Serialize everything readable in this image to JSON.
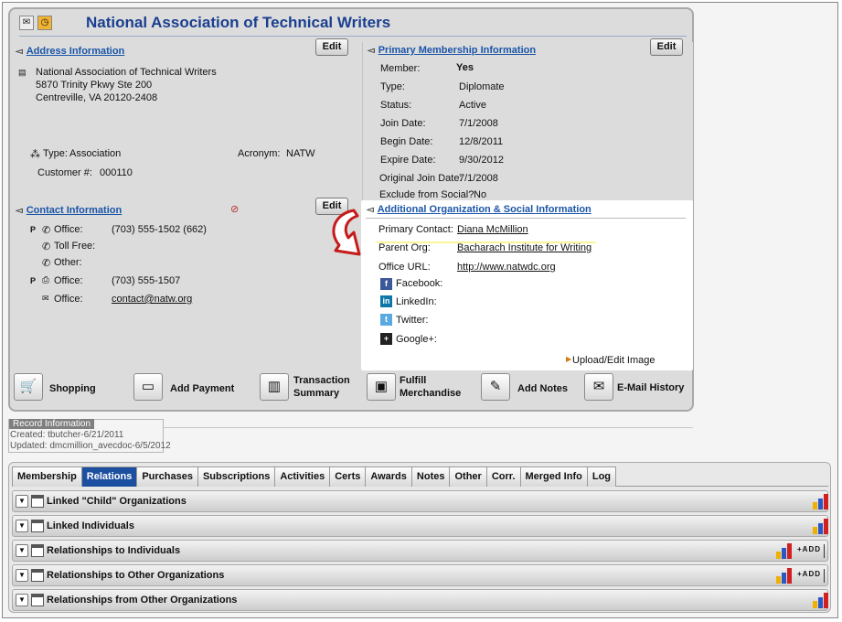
{
  "title": "National Association of Technical Writers",
  "address": {
    "section_title": "Address Information",
    "edit_label": "Edit",
    "lines": [
      "National Association of Technical Writers",
      "5870 Trinity Pkwy Ste 200",
      "Centreville, VA 20120-2408"
    ],
    "type_label": "Type:",
    "type_value": "Association",
    "acronym_label": "Acronym:",
    "acronym_value": "NATW",
    "customer_label": "Customer #:",
    "customer_value": "000110"
  },
  "contact": {
    "section_title": "Contact Information",
    "edit_label": "Edit",
    "rows": [
      {
        "prefix": "P",
        "icon": "phone-icon",
        "label": "Office:",
        "value": "(703) 555-1502 (662)"
      },
      {
        "prefix": "",
        "icon": "phone-icon",
        "label": "Toll Free:",
        "value": ""
      },
      {
        "prefix": "",
        "icon": "phone-icon",
        "label": "Other:",
        "value": ""
      },
      {
        "prefix": "P",
        "icon": "fax-icon",
        "label": "Office:",
        "value": "(703) 555-1507"
      },
      {
        "prefix": "",
        "icon": "mail-icon",
        "label": "Office:",
        "value": "contact@natw.org"
      }
    ]
  },
  "membership": {
    "section_title": "Primary Membership Information",
    "edit_label": "Edit",
    "rows": [
      {
        "label": "Member:",
        "value": "Yes"
      },
      {
        "label": "Type:",
        "value": "Diplomate"
      },
      {
        "label": "Status:",
        "value": "Active"
      },
      {
        "label": "Join Date:",
        "value": "7/1/2008"
      },
      {
        "label": "Begin Date:",
        "value": "12/8/2011"
      },
      {
        "label": "Expire Date:",
        "value": "9/30/2012"
      },
      {
        "label": "Original Join Date:",
        "value": "7/1/2008"
      },
      {
        "label": "Exclude from Social?",
        "value": "No"
      }
    ]
  },
  "social": {
    "section_title": "Additional Organization & Social Information",
    "primary_contact_label": "Primary Contact:",
    "primary_contact_value": "Diana McMillion",
    "parent_org_label": "Parent Org:",
    "parent_org_value": "Bacharach Institute for Writing",
    "office_url_label": "Office URL:",
    "office_url_value": "http://www.natwdc.org",
    "networks": [
      "Facebook:",
      "LinkedIn:",
      "Twitter:",
      "Google+:"
    ],
    "upload_label": "Upload/Edit Image"
  },
  "toolbar": {
    "shopping": "Shopping",
    "add_payment": "Add Payment",
    "transaction_1": "Transaction",
    "transaction_2": "Summary",
    "fulfill_1": "Fulfill",
    "fulfill_2": "Merchandise",
    "add_notes": "Add Notes",
    "email_history": "E-Mail History"
  },
  "record": {
    "label": "Record Information",
    "created": "Created: tbutcher-6/21/2011",
    "updated": "Updated: dmcmillion_avecdoc-6/5/2012"
  },
  "tabs": [
    "Membership",
    "Relations",
    "Purchases",
    "Subscriptions",
    "Activities",
    "Certs",
    "Awards",
    "Notes",
    "Other",
    "Corr.",
    "Merged Info",
    "Log"
  ],
  "relations": [
    {
      "label": "Linked \"Child\" Organizations",
      "add": ""
    },
    {
      "label": "Linked Individuals",
      "add": ""
    },
    {
      "label": "Relationships to Individuals",
      "add": "ADD"
    },
    {
      "label": "Relationships to Other Organizations",
      "add": "ADD"
    },
    {
      "label": "Relationships from Other Organizations",
      "add": ""
    }
  ],
  "colors": {
    "title": "#1a3f8f",
    "section": "#1a55a8",
    "active_tab": "#1d4fa0",
    "highlight": "#fbf59a"
  }
}
